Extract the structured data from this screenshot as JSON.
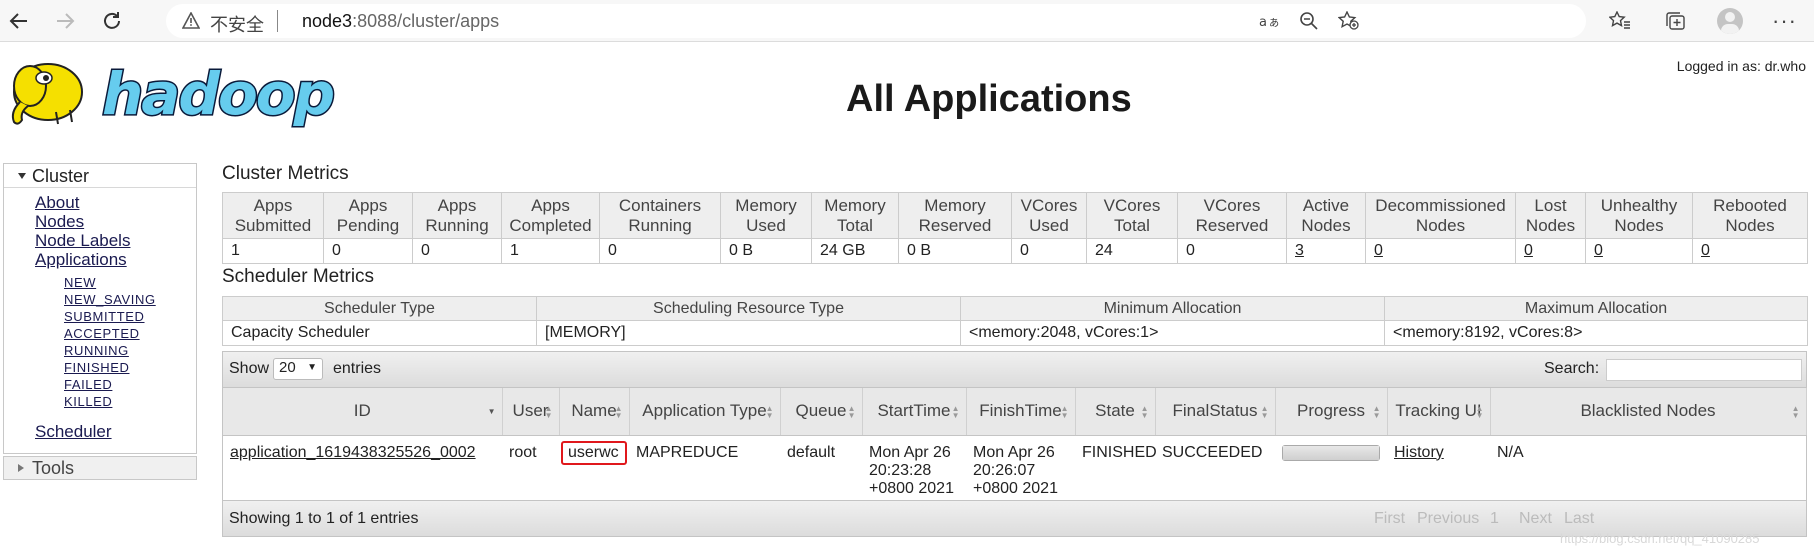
{
  "browser": {
    "insecure_label": "不安全",
    "url_host": "node3",
    "url_rest": ":8088/cluster/apps"
  },
  "header": {
    "title": "All Applications",
    "logged_in": "Logged in as: dr.who",
    "logo_text": "hadoop"
  },
  "sidebar": {
    "cluster_label": "Cluster",
    "about": "About",
    "nodes": "Nodes",
    "node_labels": "Node Labels",
    "applications": "Applications",
    "states": [
      "NEW",
      "NEW_SAVING",
      "SUBMITTED",
      "ACCEPTED",
      "RUNNING",
      "FINISHED",
      "FAILED",
      "KILLED"
    ],
    "scheduler": "Scheduler",
    "tools_label": "Tools"
  },
  "cluster_metrics": {
    "title": "Cluster Metrics",
    "headers": [
      [
        "Apps",
        "Submitted"
      ],
      [
        "Apps",
        "Pending"
      ],
      [
        "Apps",
        "Running"
      ],
      [
        "Apps",
        "Completed"
      ],
      [
        "Containers",
        "Running"
      ],
      [
        "Memory",
        "Used"
      ],
      [
        "Memory",
        "Total"
      ],
      [
        "Memory",
        "Reserved"
      ],
      [
        "VCores",
        "Used"
      ],
      [
        "VCores",
        "Total"
      ],
      [
        "VCores",
        "Reserved"
      ],
      [
        "Active",
        "Nodes"
      ],
      [
        "Decommissioned",
        "Nodes"
      ],
      [
        "Lost",
        "Nodes"
      ],
      [
        "Unhealthy",
        "Nodes"
      ],
      [
        "Rebooted",
        "Nodes"
      ]
    ],
    "values": [
      "1",
      "0",
      "0",
      "1",
      "0",
      "0 B",
      "24 GB",
      "0 B",
      "0",
      "24",
      "0",
      "3",
      "0",
      "0",
      "0",
      "0"
    ]
  },
  "scheduler_metrics": {
    "title": "Scheduler Metrics",
    "headers": [
      "Scheduler Type",
      "Scheduling Resource Type",
      "Minimum Allocation",
      "Maximum Allocation"
    ],
    "values": [
      "Capacity Scheduler",
      "[MEMORY]",
      "<memory:2048, vCores:1>",
      "<memory:8192, vCores:8>"
    ]
  },
  "apps_table": {
    "show_label": "Show",
    "page_length": "20",
    "entries_label": "entries",
    "search_label": "Search:",
    "search_value": "",
    "headers": [
      "ID",
      "User",
      "Name",
      "Application Type",
      "Queue",
      "StartTime",
      "FinishTime",
      "State",
      "FinalStatus",
      "Progress",
      "Tracking UI",
      "Blacklisted Nodes"
    ],
    "rows": [
      {
        "id": "application_1619438325526_0002",
        "user": "root",
        "name": "userwc",
        "type": "MAPREDUCE",
        "queue": "default",
        "start_time": [
          "Mon Apr 26",
          "20:23:28",
          "+0800 2021"
        ],
        "finish_time": [
          "Mon Apr 26",
          "20:26:07",
          "+0800 2021"
        ],
        "state": "FINISHED",
        "final_status": "SUCCEEDED",
        "progress": 1.0,
        "tracking_ui": "History",
        "blacklisted": "N/A"
      }
    ],
    "info": "Showing 1 to 1 of 1 entries",
    "pager": {
      "first": "First",
      "previous": "Previous",
      "page": "1",
      "next": "Next",
      "last": "Last"
    }
  },
  "watermark": "https://blog.csdn.net/qq_41090285",
  "colors": {
    "highlight": "#e0181c",
    "logo_yellow": "#f5e000",
    "logo_blue": "#66ccee"
  }
}
